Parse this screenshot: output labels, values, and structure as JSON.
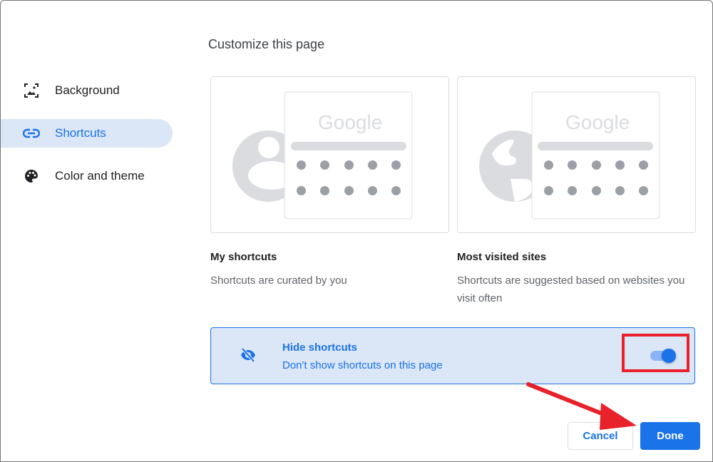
{
  "dialog": {
    "title": "Customize this page"
  },
  "sidebar": {
    "items": [
      {
        "label": "Background",
        "icon": "image-frame-icon",
        "active": false
      },
      {
        "label": "Shortcuts",
        "icon": "link-icon",
        "active": true
      },
      {
        "label": "Color and theme",
        "icon": "palette-icon",
        "active": false
      }
    ]
  },
  "options": [
    {
      "title": "My shortcuts",
      "description": "Shortcuts are curated by you",
      "illustration": "person-icon",
      "logo_text": "Google"
    },
    {
      "title": "Most visited sites",
      "description": "Shortcuts are suggested based on websites you visit often",
      "illustration": "globe-icon",
      "logo_text": "Google"
    }
  ],
  "hide_shortcuts": {
    "title": "Hide shortcuts",
    "description": "Don't show shortcuts on this page",
    "icon": "eye-off-icon",
    "enabled": true
  },
  "buttons": {
    "cancel": "Cancel",
    "done": "Done"
  },
  "annotations": {
    "highlight_color": "#e8212b",
    "arrow_color": "#e8212b"
  },
  "colors": {
    "accent": "#1a73e8",
    "selected_bg": "#dbe6f7"
  }
}
